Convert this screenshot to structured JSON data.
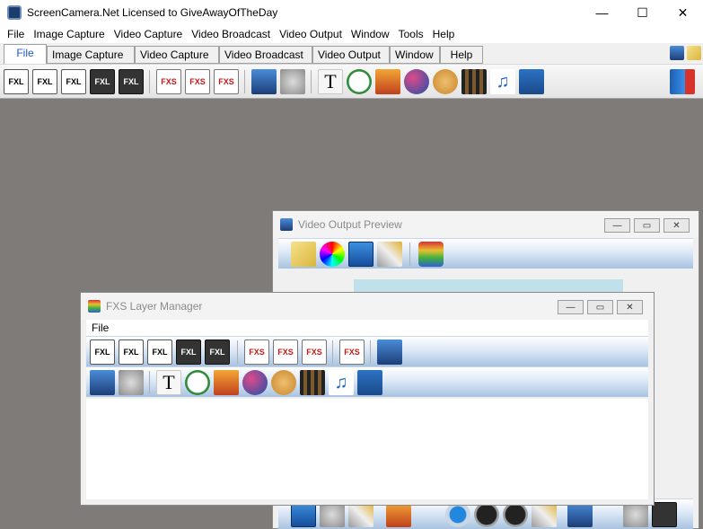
{
  "app": {
    "title": "ScreenCamera.Net Licensed to GiveAwayOfTheDay",
    "window_controls": {
      "minimize": "—",
      "maximize": "☐",
      "close": "✕"
    }
  },
  "menubar": [
    "File",
    "Image Capture",
    "Video Capture",
    "Video Broadcast",
    "Video Output",
    "Window",
    "Tools",
    "Help"
  ],
  "tabs": [
    "File",
    "Image Capture",
    "Video Capture",
    "Video Broadcast",
    "Video Output",
    "Window",
    "Help"
  ],
  "main_toolbar": {
    "fxl_label": "FXL",
    "fxs_label": "FXS",
    "text_label": "T",
    "music_label": "♫"
  },
  "video_output_preview": {
    "title": "Video Output Preview",
    "min": "—",
    "max": "▭",
    "close": "✕"
  },
  "fxs_layer_manager": {
    "title": "FXS Layer Manager",
    "menu": [
      "File"
    ],
    "min": "—",
    "max": "▭",
    "close": "✕",
    "fxl_label": "FXL",
    "fxs_label": "FXS",
    "text_label": "T",
    "music_label": "♫"
  },
  "colors": {
    "workspace": "#7f7b79",
    "active_tab_text": "#1e5bc8",
    "toolbar_blue": "#a8c3e0"
  }
}
